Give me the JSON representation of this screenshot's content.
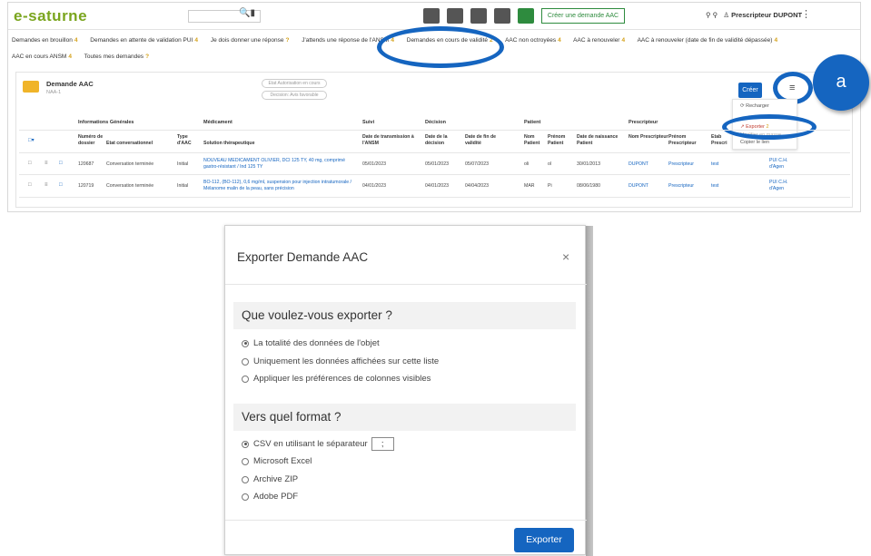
{
  "app": {
    "logo": "e-saturne",
    "create_aac_label": "Créer une demande AAC",
    "user_name": "Prescripteur DUPONT",
    "search_icon": "search-icon"
  },
  "tabs_row1": [
    {
      "label": "Demandes en brouillon",
      "count": "4"
    },
    {
      "label": "Demandes en attente de validation PUI",
      "count": "4"
    },
    {
      "label": "Je dois donner une réponse",
      "count": "?"
    },
    {
      "label": "J'attends une réponse de l'ANSM",
      "count": "4"
    },
    {
      "label": "Demandes en cours de validité",
      "count": "2"
    },
    {
      "label": "AAC non octroyées",
      "count": "4"
    },
    {
      "label": "AAC à renouveler",
      "count": "4"
    },
    {
      "label": "AAC à renouveler (date de fin de validité dépassée)",
      "count": "4"
    }
  ],
  "tabs_row2": [
    {
      "label": "AAC en cours ANSM",
      "count": "4"
    },
    {
      "label": "Toutes mes demandes",
      "count": "?"
    }
  ],
  "list": {
    "title": "Demande AAC",
    "subtitle": "NAA-1",
    "filter1": "Etat Autorisation en cours",
    "filter2": "Decision: Avis favorable",
    "create_label": "Créer",
    "menu": {
      "reload": "Recharger",
      "export": "Exporter",
      "export_count": "2",
      "other": "Modifier en masse",
      "copy": "Copier le lien"
    },
    "groups": {
      "general": "Informations Générales",
      "medicament": "Médicament",
      "suivi": "Suivi",
      "decision": "Décision",
      "patient": "Patient",
      "prescripteur": "Prescripteur"
    },
    "headers": {
      "numero": "Numéro de dossier",
      "etat": "Etat conversationnel",
      "type": "Type d'AAC",
      "solution": "Solution thérapeutique",
      "date_trans": "Date de transmission à l'ANSM",
      "date_dec": "Date de la décision",
      "date_fin": "Date de fin de validité",
      "nom_pat": "Nom Patient",
      "prenom_pat": "Prénom Patient",
      "naissance": "Date de naissance Patient",
      "nom_presc": "Nom Prescripteur",
      "prenom_presc": "Prénom Prescripteur",
      "etab": "Etab Prescri"
    },
    "rows": [
      {
        "numero": "120687",
        "etat": "Conversation terminée",
        "type": "Initial",
        "solution": "NOUVEAU MEDICAMENT OLIVIER, DCI 125 TY, 40 mg, comprimé gastro-résistant / Ind 125 TY",
        "date_trans": "05/01/2023",
        "date_dec": "05/01/2023",
        "date_fin": "05/07/2023",
        "nom_pat": "oli",
        "prenom_pat": "ol",
        "naissance": "30/01/2013",
        "nom_presc": "DUPONT",
        "prenom_presc": "Prescripteur",
        "etab": "test",
        "pui": "PUI C.H. d'Agen"
      },
      {
        "numero": "120719",
        "etat": "Conversation terminée",
        "type": "Initial",
        "solution": "BO-112, (BO-112), 0,6 mg/ml, suspension pour injection intratumorale / Mélanome malin de la peau, sans précision",
        "date_trans": "04/01/2023",
        "date_dec": "04/01/2023",
        "date_fin": "04/04/2023",
        "nom_pat": "MAR",
        "prenom_pat": "Pi",
        "naissance": "08/06/1980",
        "nom_presc": "DUPONT",
        "prenom_presc": "Prescripteur",
        "etab": "test",
        "pui": "PUI C.H. d'Agen"
      }
    ]
  },
  "annotation_badge": "a",
  "dialog": {
    "title": "Exporter Demande AAC",
    "close": "×",
    "section1": "Que voulez-vous exporter ?",
    "options1": [
      {
        "label": "La totalité des données de l'objet",
        "checked": true
      },
      {
        "label": "Uniquement les données affichées sur cette liste",
        "checked": false
      },
      {
        "label": "Appliquer les préférences de colonnes visibles",
        "checked": false
      }
    ],
    "section2": "Vers quel format ?",
    "csv_label": "CSV  en utilisant le séparateur",
    "separator": ";",
    "options2": [
      {
        "label": "Microsoft Excel",
        "checked": false
      },
      {
        "label": "Archive ZIP",
        "checked": false
      },
      {
        "label": "Adobe PDF",
        "checked": false
      }
    ],
    "export_label": "Exporter"
  }
}
